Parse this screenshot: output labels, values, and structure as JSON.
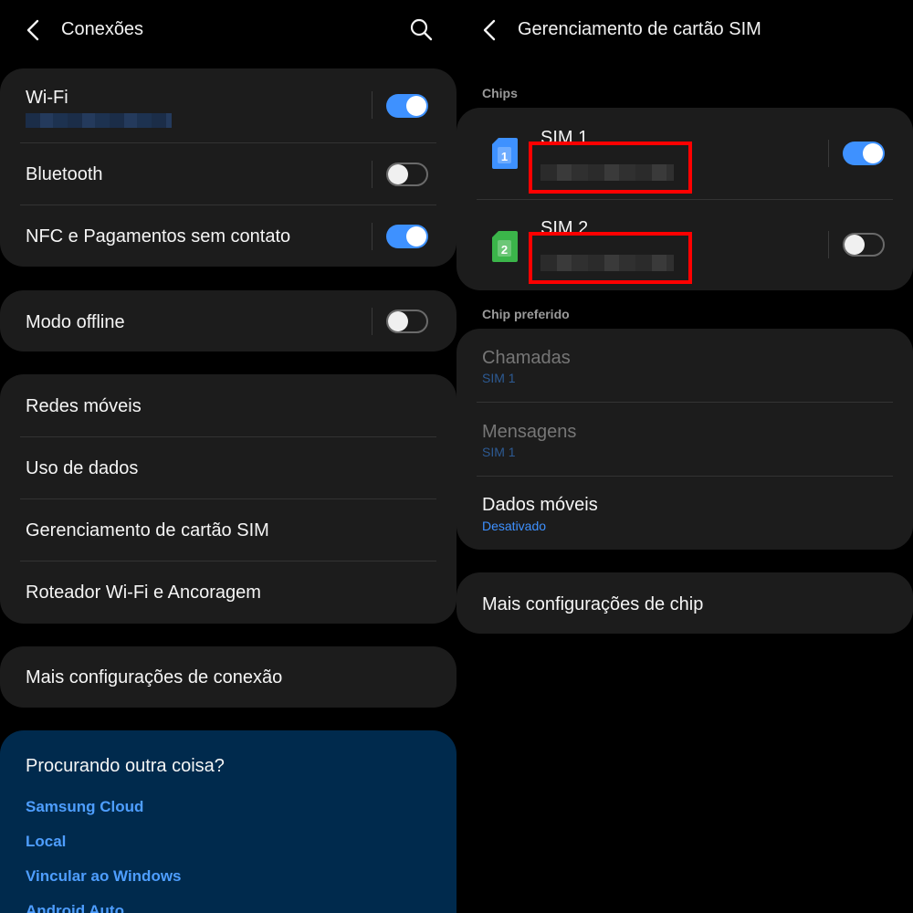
{
  "left": {
    "title": "Conexões",
    "groups": {
      "wifi": {
        "label": "Wi-Fi",
        "enabled": true
      },
      "bluetooth": {
        "label": "Bluetooth",
        "enabled": false
      },
      "nfc": {
        "label": "NFC e Pagamentos sem contato",
        "enabled": true
      },
      "offline": {
        "label": "Modo offline",
        "enabled": false
      }
    },
    "menu": [
      "Redes móveis",
      "Uso de dados",
      "Gerenciamento de cartão SIM",
      "Roteador Wi-Fi e Ancoragem"
    ],
    "more": "Mais configurações de conexão",
    "help": {
      "title": "Procurando outra coisa?",
      "links": [
        "Samsung Cloud",
        "Local",
        "Vincular ao Windows",
        "Android Auto"
      ]
    }
  },
  "right": {
    "title": "Gerenciamento de cartão SIM",
    "chips_label": "Chips",
    "sims": [
      {
        "name": "SIM 1",
        "number_badge": "1",
        "color": "#3e91ff",
        "enabled": true
      },
      {
        "name": "SIM 2",
        "number_badge": "2",
        "color": "#3bb54a",
        "enabled": false
      }
    ],
    "preferred_label": "Chip preferido",
    "preferred": [
      {
        "title": "Chamadas",
        "value": "SIM 1"
      },
      {
        "title": "Mensagens",
        "value": "SIM 1"
      },
      {
        "title": "Dados móveis",
        "value": "Desativado"
      }
    ],
    "more": "Mais configurações de chip"
  },
  "colors": {
    "accent": "#3e91ff",
    "highlight": "#ff0000",
    "help_bg": "#002a4d"
  }
}
